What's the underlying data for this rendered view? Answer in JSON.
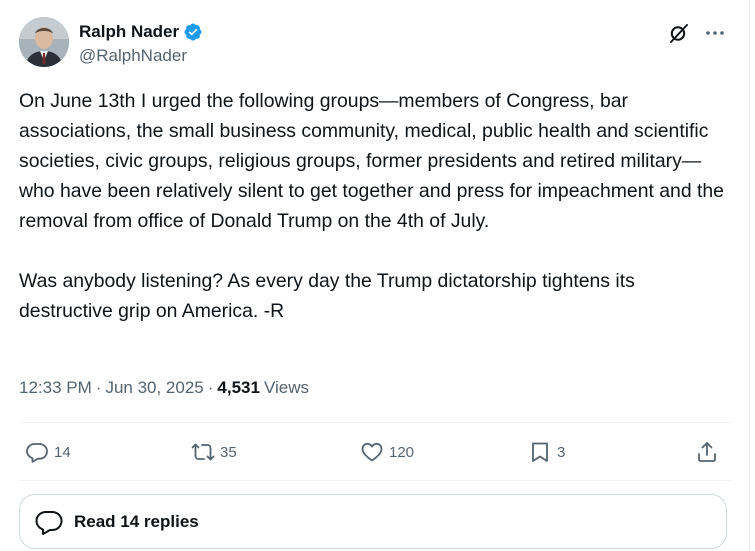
{
  "author": {
    "display_name": "Ralph Nader",
    "handle": "@RalphNader",
    "verified": true,
    "verified_color": "#1d9bf0"
  },
  "tweet": {
    "text": "On June 13th I urged the following groups—members of Congress, bar associations, the small business community, medical, public health and scientific societies, civic groups, religious groups, former presidents and retired military—who have been relatively silent to get together and press for impeachment and the removal from office of Donald Trump on the 4th of July.\n\nWas anybody listening? As every day the Trump dictatorship tightens its destructive grip on America. -R",
    "time": "12:33 PM",
    "separator": "·",
    "date": "Jun 30, 2025",
    "views_count": "4,531",
    "views_label": "Views"
  },
  "actions": {
    "reply_count": "14",
    "retweet_count": "35",
    "like_count": "120",
    "bookmark_count": "3"
  },
  "icons": {
    "reply": "reply-icon",
    "retweet": "retweet-icon",
    "like": "heart-icon",
    "bookmark": "bookmark-icon",
    "share": "share-icon",
    "grok": "grok-icon",
    "more": "more-icon"
  },
  "replies_button": {
    "label": "Read 14 replies"
  },
  "colors": {
    "text": "#0f1419",
    "secondary": "#536471",
    "border": "#cfd9de",
    "divider": "#eff3f4"
  }
}
